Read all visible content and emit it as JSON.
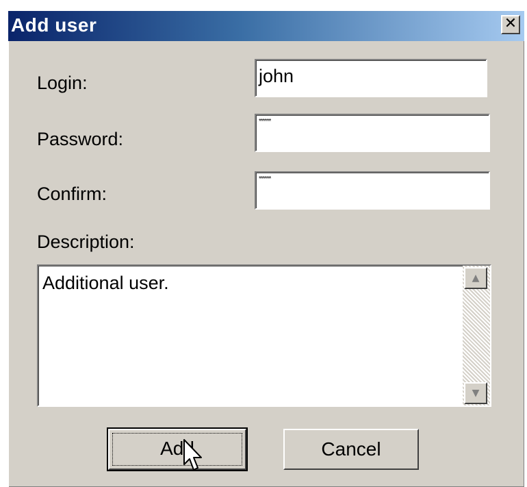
{
  "window": {
    "title": "Add user",
    "close_label": "✕"
  },
  "form": {
    "login_label": "Login:",
    "login_value": "john",
    "password_label": "Password:",
    "password_value": "******",
    "confirm_label": "Confirm:",
    "confirm_value": "******",
    "description_label": "Description:",
    "description_value": "Additional user."
  },
  "scrollbar": {
    "up_glyph": "▲",
    "down_glyph": "▼"
  },
  "buttons": {
    "add_label": "Add",
    "cancel_label": "Cancel"
  },
  "colors": {
    "titlebar_start": "#0a246a",
    "titlebar_end": "#a6caf0",
    "dialog_face": "#d4d0c8"
  },
  "icons": {
    "close": "close-icon",
    "pointer": "mouse-pointer-icon"
  }
}
